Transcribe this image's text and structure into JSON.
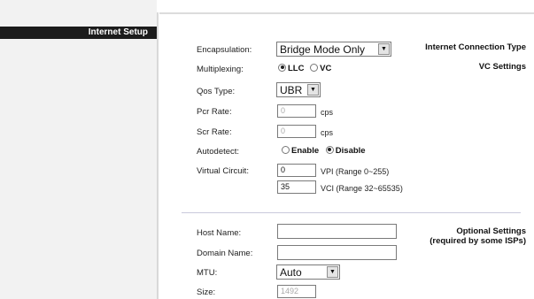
{
  "sidebar": {
    "section_title": "Internet Setup",
    "internet_connection_type": "Internet Connection Type",
    "vc_settings": "VC Settings",
    "optional_line1": "Optional Settings",
    "optional_line2": "(required by some ISPs)"
  },
  "form": {
    "encapsulation": {
      "label": "Encapsulation:",
      "value": "Bridge Mode Only"
    },
    "multiplexing": {
      "label": "Multiplexing:",
      "options": [
        "LLC",
        "VC"
      ],
      "selected": "LLC"
    },
    "qos_type": {
      "label": "Qos Type:",
      "value": "UBR"
    },
    "pcr_rate": {
      "label": "Pcr Rate:",
      "value": "0",
      "unit": "cps"
    },
    "scr_rate": {
      "label": "Scr Rate:",
      "value": "0",
      "unit": "cps"
    },
    "autodetect": {
      "label": "Autodetect:",
      "options": [
        "Enable",
        "Disable"
      ],
      "selected": "Disable"
    },
    "virtual_circuit": {
      "label": "Virtual Circuit:",
      "vpi_value": "0",
      "vpi_range": "VPI (Range 0~255)",
      "vci_value": "35",
      "vci_range": "VCI (Range 32~65535)"
    },
    "host_name": {
      "label": "Host Name:",
      "value": ""
    },
    "domain_name": {
      "label": "Domain Name:",
      "value": ""
    },
    "mtu": {
      "label": "MTU:",
      "value": "Auto"
    },
    "size": {
      "label": "Size:",
      "value": "1492"
    }
  }
}
